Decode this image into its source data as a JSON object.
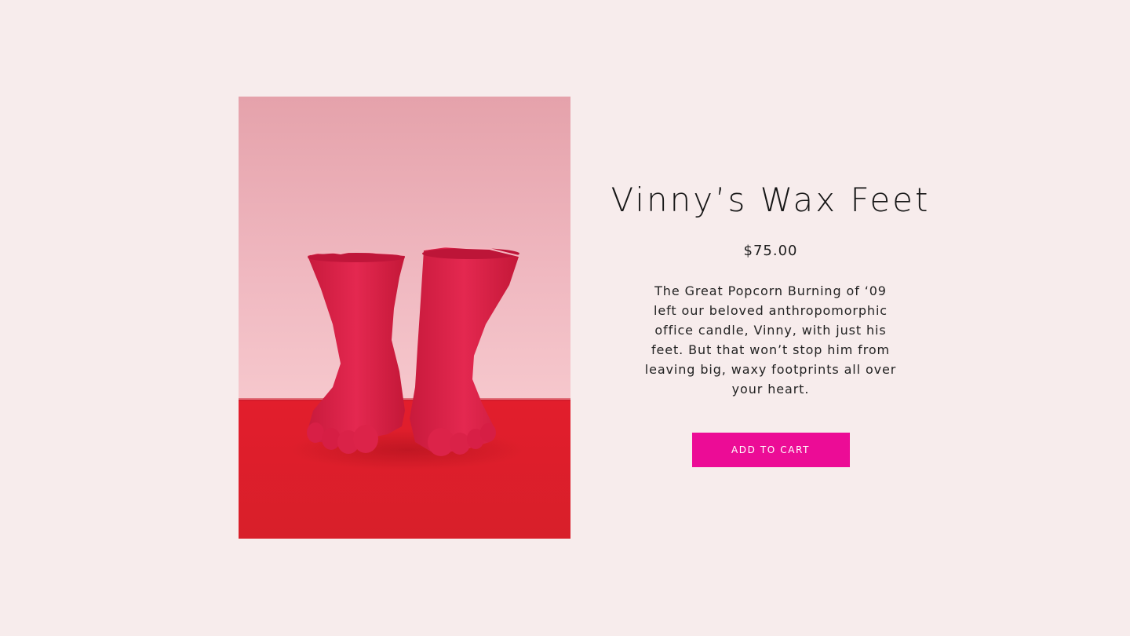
{
  "product": {
    "title": "Vinny’s Wax Feet",
    "price": "$75.00",
    "description": "The Great Popcorn Burning of ‘09 left our beloved anthropomorphic office candle, Vinny, with just his feet. But that won’t stop him from leaving big, waxy footprints all over your heart.",
    "image_icon": "wax-feet-photo",
    "add_to_cart_label": "ADD TO CART"
  },
  "colors": {
    "page_background": "#f7ecec",
    "button_background": "#ec0c96",
    "button_text": "#ffffff",
    "wall": "#e9a4ad",
    "floor": "#dd1e2a",
    "wax": "#dc2044"
  }
}
